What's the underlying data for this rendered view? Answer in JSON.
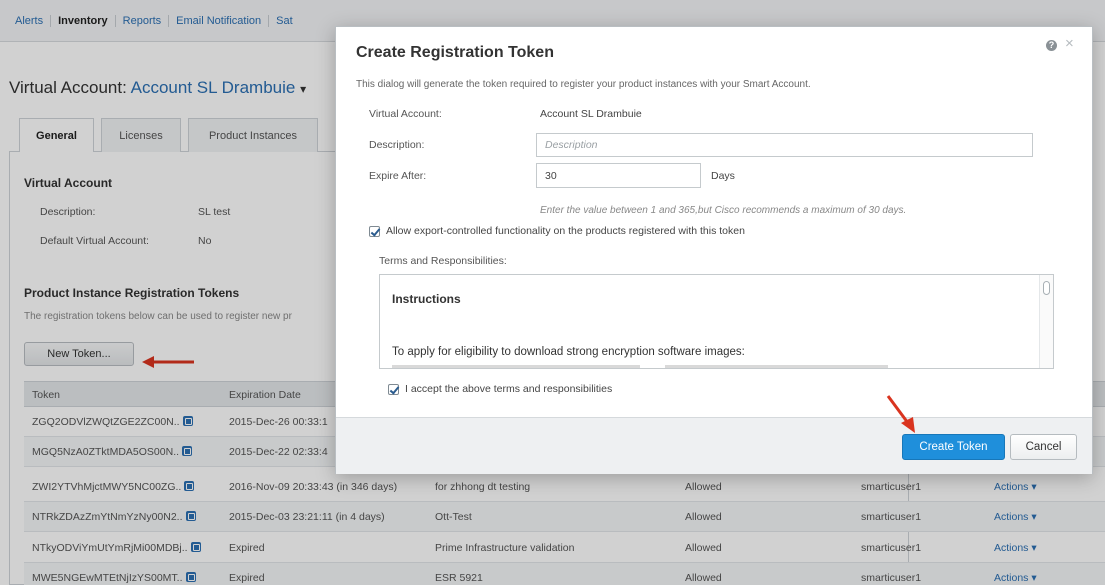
{
  "topnav": {
    "items": [
      {
        "label": "Alerts"
      },
      {
        "label": "Inventory"
      },
      {
        "label": "Reports"
      },
      {
        "label": "Email Notification"
      },
      {
        "label": "Sat"
      }
    ]
  },
  "page": {
    "title_prefix": "Virtual Account:",
    "account_name": "Account SL Drambuie",
    "caret": "▾",
    "tabs": [
      {
        "label": "General"
      },
      {
        "label": "Licenses"
      },
      {
        "label": "Product Instances"
      }
    ],
    "virtual_account": {
      "title": "Virtual Account",
      "description_label": "Description:",
      "description_value": "SL test",
      "default_label": "Default Virtual Account:",
      "default_value": "No"
    },
    "tokens_section": {
      "title": "Product Instance Registration Tokens",
      "subtitle": "The registration tokens below can be used to register new pr",
      "new_token_button": "New Token..."
    },
    "table": {
      "headers": [
        "Token",
        "Expiration Date"
      ],
      "rows": [
        {
          "token": "ZGQ2ODVlZWQtZGE2ZC00N..",
          "expiration": "2015-Dec-26 00:33:1",
          "description": "",
          "export": "",
          "created_by": "",
          "actions": ""
        },
        {
          "token": "MGQ5NzA0ZTktMDA5OS00N..",
          "expiration": "2015-Dec-22 02:33:4",
          "description": "",
          "export": "",
          "created_by": "",
          "actions": ""
        },
        {
          "token": "ZWI2YTVhMjctMWY5NC00ZG..",
          "expiration": "2016-Nov-09 20:33:43 (in 346 days)",
          "description": "for zhhong dt testing",
          "export": "Allowed",
          "created_by": "smarticuser1",
          "actions": "Actions ▾"
        },
        {
          "token": "NTRkZDAzZmYtNmYzNy00N2..",
          "expiration": "2015-Dec-03 23:21:11 (in 4 days)",
          "description": "Ott-Test",
          "export": "Allowed",
          "created_by": "smarticuser1",
          "actions": "Actions ▾"
        },
        {
          "token": "NTkyODViYmUtYmRjMi00MDBj..",
          "expiration": "Expired",
          "description": "Prime Infrastructure validation",
          "export": "Allowed",
          "created_by": "smarticuser1",
          "actions": "Actions ▾"
        },
        {
          "token": "MWE5NGEwMTEtNjIzYS00MT..",
          "expiration": "Expired",
          "description": "ESR 5921",
          "export": "Allowed",
          "created_by": "smarticuser1",
          "actions": "Actions ▾"
        }
      ]
    }
  },
  "modal": {
    "title": "Create Registration Token",
    "description": "This dialog will generate the token required to register your product instances with your Smart Account.",
    "virtual_account_label": "Virtual Account:",
    "virtual_account_value": "Account SL Drambuie",
    "description_label": "Description:",
    "description_placeholder": "Description",
    "expire_label": "Expire After:",
    "expire_value": "30",
    "expire_unit": "Days",
    "expire_hint": "Enter the value between 1 and 365,but Cisco recommends a maximum of 30 days.",
    "export_check_label": "Allow export-controlled functionality on the products registered with this token",
    "export_checked": true,
    "terms_label": "Terms and Responsibilities:",
    "terms_heading": "Instructions",
    "terms_body": "To apply for eligibility to download strong encryption software images:",
    "accept_label": "I accept the above terms and responsibilities",
    "accept_checked": true,
    "create_button": "Create Token",
    "cancel_button": "Cancel"
  },
  "colors": {
    "link": "#2b6fb3",
    "primary_button": "#1f8fdb",
    "annotation_arrow": "#d9341f"
  }
}
